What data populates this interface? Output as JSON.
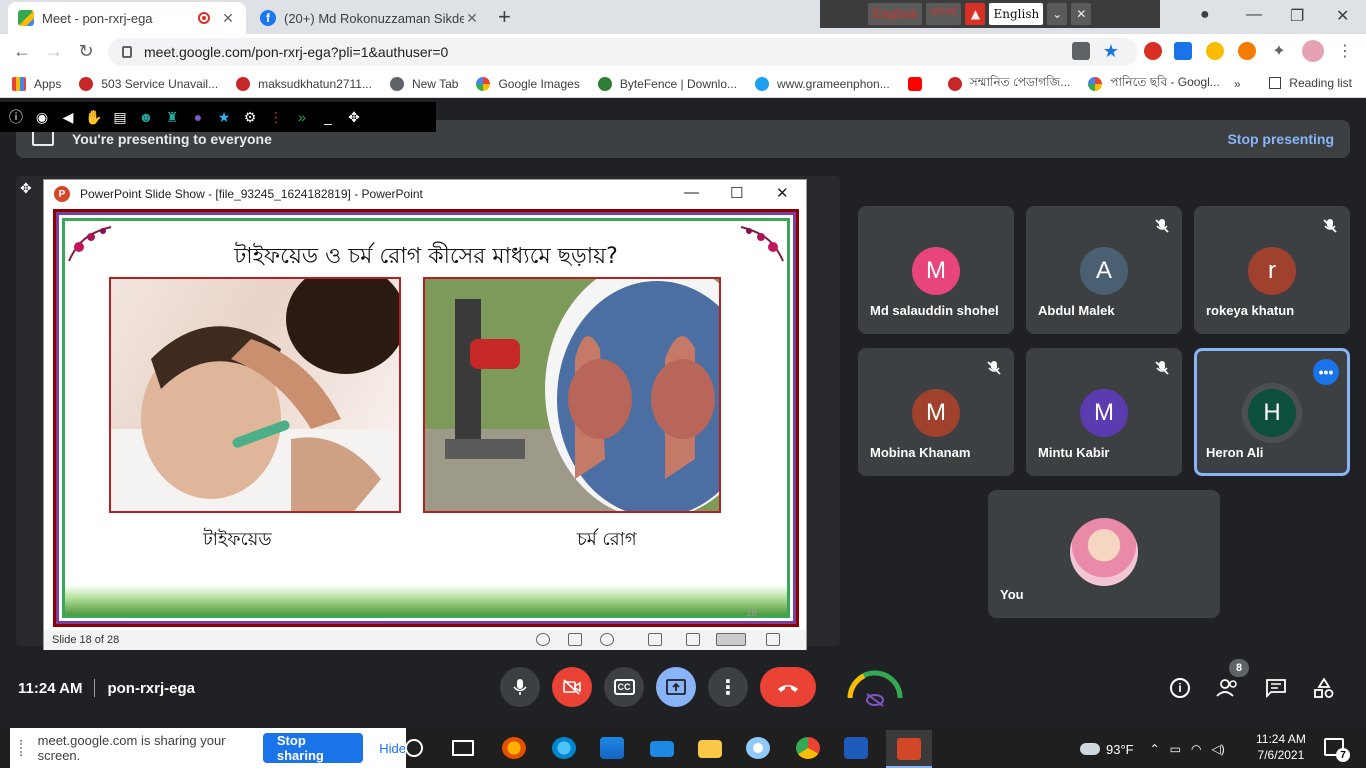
{
  "browser": {
    "tabs": [
      {
        "title": "Meet - pon-rxrj-ega",
        "active": true
      },
      {
        "title": "(20+) Md Rokonuzzaman Sikder",
        "active": false
      }
    ],
    "lang_bar": {
      "item1": "English",
      "item2": "বাংলা",
      "item3": "English"
    },
    "url": "meet.google.com/pon-rxrj-ega?pli=1&authuser=0",
    "bookmarks": [
      "Apps",
      "503 Service Unavail...",
      "maksudkhatun2711...",
      "New Tab",
      "Google Images",
      "ByteFence | Downlo...",
      "www.grameenphon...",
      "সম্মানিত পেডাগজি...",
      "পানিতে ছবি - Googl..."
    ],
    "bookmarks_more": "»",
    "reading_list": "Reading list"
  },
  "meet": {
    "banner_text": "You're presenting to everyone",
    "stop_presenting": "Stop presenting",
    "time": "11:24 AM",
    "meeting_code": "pon-rxrj-ega",
    "people_count": "8",
    "participants": [
      {
        "initial": "M",
        "name": "Md salauddin shohel",
        "color": "#e8457c",
        "muted": false
      },
      {
        "initial": "A",
        "name": "Abdul Malek",
        "color": "#4b5f73",
        "muted": true
      },
      {
        "initial": "r",
        "name": "rokeya khatun",
        "color": "#a0412d",
        "muted": true
      },
      {
        "initial": "M",
        "name": "Mobina Khanam",
        "color": "#a0412d",
        "muted": true
      },
      {
        "initial": "M",
        "name": "Mintu Kabir",
        "color": "#5b3bb0",
        "muted": true
      },
      {
        "initial": "H",
        "name": "Heron Ali",
        "color": "#0d5040",
        "muted": false
      },
      {
        "initial": "",
        "name": "You",
        "color": "#f3c6d3",
        "muted": false
      }
    ]
  },
  "ppt": {
    "window_title": "PowerPoint Slide Show - [file_93245_1624182819] - PowerPoint",
    "slide_title": "টাইফয়েড ও চর্ম রোগ কীসের মাধ্যমে ছড়ায়?",
    "caption_left": "টাইফয়েড",
    "caption_right": "চর্ম রোগ",
    "status": "Slide 18 of 28",
    "slide_marker": "18"
  },
  "sharing": {
    "notice": "meet.google.com is sharing your screen.",
    "stop_label": "Stop sharing",
    "hide_label": "Hide"
  },
  "taskbar": {
    "weather": "93°F",
    "time": "11:24 AM",
    "date": "7/6/2021",
    "notification_count": "7"
  },
  "colors": {
    "meet_bg": "#202124",
    "tile_bg": "#3c4043",
    "accent_blue": "#8ab4f8",
    "end_call_red": "#ea4335"
  }
}
